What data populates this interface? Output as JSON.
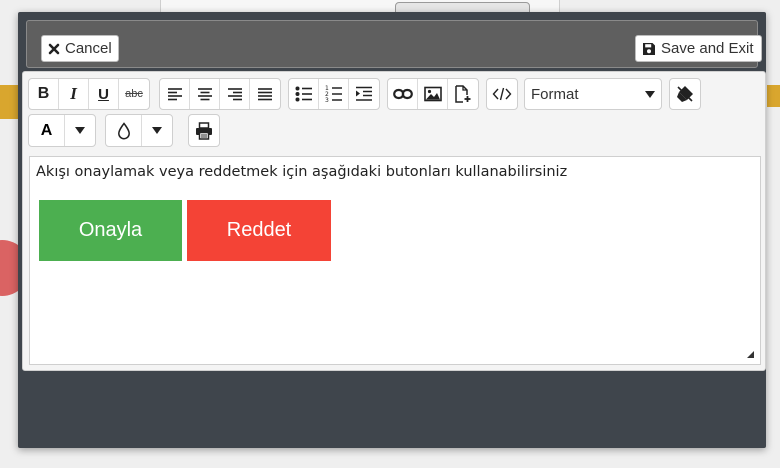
{
  "topbar": {
    "cancel_label": "Cancel",
    "cancel_icon": "close-icon",
    "save_label": "Save and Exit",
    "save_icon": "save-icon"
  },
  "toolbar": {
    "bold": "B",
    "italic": "I",
    "underline": "U",
    "strikethrough": "abc",
    "format_select_value": "Format",
    "font_color_label": "A"
  },
  "editor": {
    "content_text": "Akışı onaylamak veya reddetmek için aşağıdaki butonları kullanabilirsiniz",
    "approve_label": "Onayla",
    "reject_label": "Reddet"
  },
  "colors": {
    "approve": "#4caf50",
    "reject": "#f44336",
    "modal_bg": "#3f454c",
    "topbar_bg": "#5f5f5f"
  }
}
